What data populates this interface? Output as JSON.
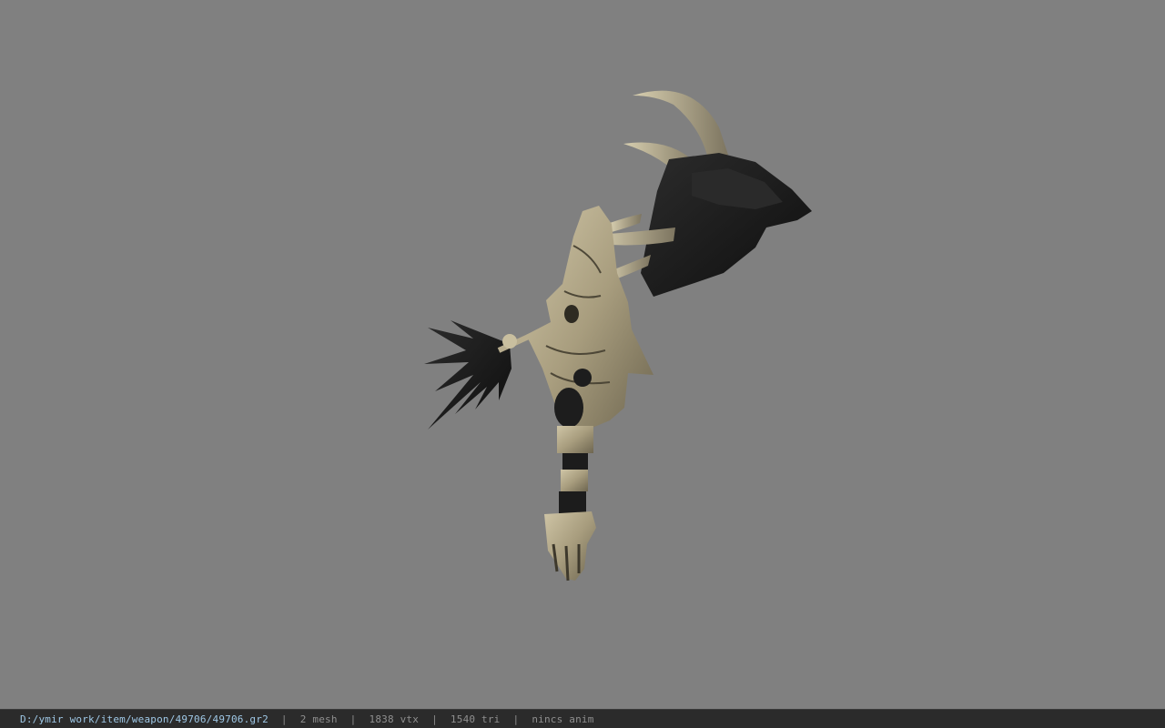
{
  "status_bar": {
    "file_path": "D:/ymir work/item/weapon/49706/49706.gr2",
    "separator": "|",
    "mesh_count": "2 mesh",
    "vertex_count": "1838 vtx",
    "triangle_count": "1540 tri",
    "animation": "nincs anim"
  },
  "colors": {
    "viewport_background": "#808080",
    "status_background": "#2b2b2b",
    "path_text": "#9fc8e6",
    "stat_text": "#8f8f8f",
    "bone_armor": "#b5ab8c",
    "fur_black": "#1c1c1c"
  },
  "icons": {
    "model": "horned-beast-weapon-model"
  }
}
